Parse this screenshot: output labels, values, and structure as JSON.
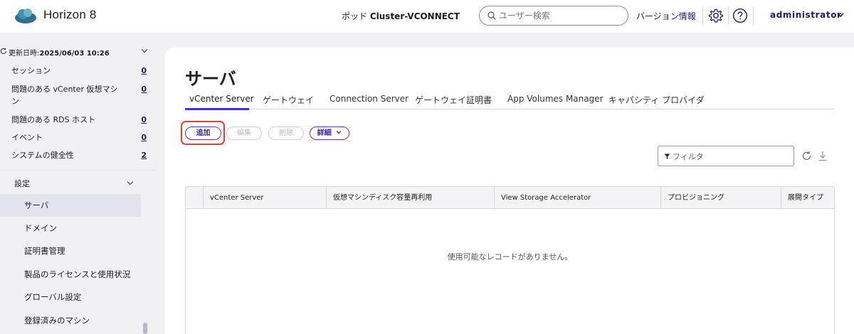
{
  "header": {
    "app_title": "Horizon 8",
    "pod_label": "ポッド",
    "pod_name": "Cluster-VCONNECT",
    "search_placeholder": "ユーザー検索",
    "about_label": "バージョン情報",
    "user_name": "administrator"
  },
  "sidebar": {
    "refresh_label": "更新日時:",
    "refresh_time": "2025/06/03 10:26",
    "stats": [
      {
        "label": "セッション",
        "count": "0"
      },
      {
        "label": "問題のある vCenter 仮想マシン",
        "count": "0"
      },
      {
        "label": "問題のある RDS ホスト",
        "count": "0"
      },
      {
        "label": "イベント",
        "count": "0"
      },
      {
        "label": "システムの健全性",
        "count": "2"
      }
    ],
    "settings_label": "設定",
    "nav_items": [
      {
        "label": "サーバ",
        "active": true
      },
      {
        "label": "ドメイン",
        "active": false
      },
      {
        "label": "証明書管理",
        "active": false
      },
      {
        "label": "製品のライセンスと使用状況",
        "active": false
      },
      {
        "label": "グローバル設定",
        "active": false
      },
      {
        "label": "登録済みのマシン",
        "active": false
      }
    ]
  },
  "main": {
    "page_title": "サーバ",
    "tabs": [
      "vCenter Server",
      "ゲートウェイ",
      "Connection Server",
      "ゲートウェイ証明書",
      "App Volumes Manager",
      "キャパシティ プロバイダ"
    ],
    "active_tab": "vCenter Server",
    "buttons": {
      "add": "追加",
      "edit": "編集",
      "delete": "削除",
      "more": "詳細"
    },
    "filter_placeholder": "フィルタ",
    "columns": [
      "vCenter Server",
      "仮想マシンディスク容量再利用",
      "View Storage Accelerator",
      "プロビジョニング",
      "展開タイプ"
    ],
    "empty_message": "使用可能なレコードがありません。"
  },
  "colors": {
    "accent": "#4a2dd0",
    "highlight_ring": "#d9432f",
    "link": "#1d1d6b"
  }
}
